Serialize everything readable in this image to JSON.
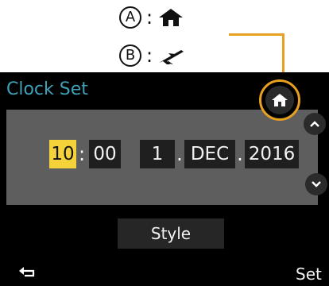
{
  "legend": {
    "a": {
      "letter": "A",
      "colon": ":",
      "icon": "home-icon"
    },
    "b": {
      "letter": "B",
      "colon": ":",
      "icon": "airplane-icon"
    }
  },
  "screen": {
    "title": "Clock Set",
    "home_button_icon": "home-icon",
    "time": {
      "hour": "10",
      "separator": ":",
      "minute": "00"
    },
    "date": {
      "day": "1",
      "sep1": ".",
      "month": "DEC",
      "sep2": ".",
      "year": "2016"
    },
    "up_button_icon": "chevron-up-icon",
    "down_button_icon": "chevron-down-icon",
    "style_button_label": "Style",
    "back_button_icon": "return-arrow-icon",
    "set_button_label": "Set"
  },
  "colors": {
    "accent_orange": "#e8a020",
    "title_teal": "#3fa0b8",
    "selected_yellow": "#f6d23a",
    "panel_gray": "#5e5e5e"
  }
}
